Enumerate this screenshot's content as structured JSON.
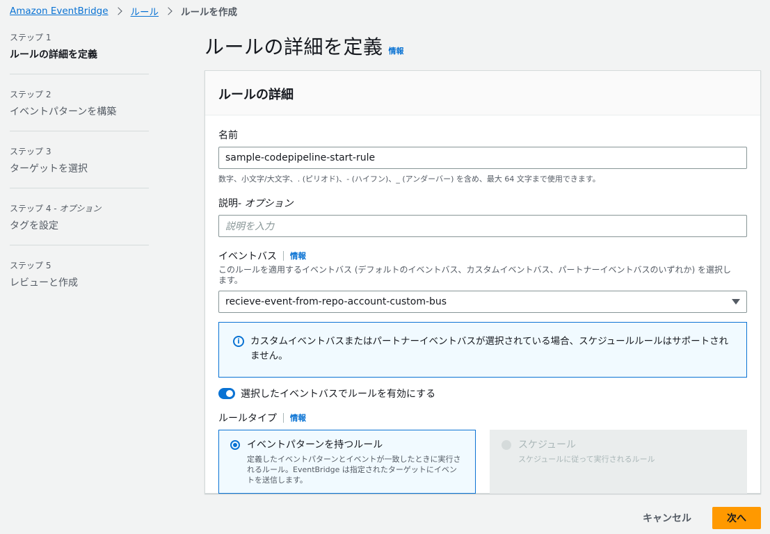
{
  "breadcrumb": {
    "items": [
      "Amazon EventBridge",
      "ルール"
    ],
    "current": "ルールを作成"
  },
  "steps": [
    {
      "num": "ステップ 1",
      "title": "ルールの詳細を定義",
      "active": true
    },
    {
      "num": "ステップ 2",
      "title": "イベントパターンを構築"
    },
    {
      "num": "ステップ 3",
      "title": "ターゲットを選択"
    },
    {
      "num": "ステップ 4",
      "optional": " - オプション",
      "title": "タグを設定"
    },
    {
      "num": "ステップ 5",
      "title": "レビューと作成"
    }
  ],
  "page": {
    "title": "ルールの詳細を定義",
    "info": "情報"
  },
  "panel": {
    "header": "ルールの詳細",
    "name": {
      "label": "名前",
      "value": "sample-codepipeline-start-rule",
      "hint": "数字、小文字/大文字、. (ピリオド)、- (ハイフン)、_ (アンダーバー) を含め、最大 64 文字まで使用できます。"
    },
    "description": {
      "label": "説明",
      "optional": " - オプション",
      "placeholder": "説明を入力"
    },
    "event_bus": {
      "label": "イベントバス",
      "info": "情報",
      "desc": "このルールを適用するイベントバス (デフォルトのイベントバス、カスタムイベントバス、パートナーイベントバスのいずれか) を選択します。",
      "value": "recieve-event-from-repo-account-custom-bus"
    },
    "alert": {
      "icon": "info-icon",
      "text": "カスタムイベントバスまたはパートナーイベントバスが選択されている場合、スケジュールルールはサポートされません。"
    },
    "toggle": {
      "label": "選択したイベントバスでルールを有効にする",
      "on": true
    },
    "rule_type": {
      "label": "ルールタイプ",
      "info": "情報",
      "options": [
        {
          "title": "イベントパターンを持つルール",
          "desc": "定義したイベントパターンとイベントが一致したときに実行されるルール。EventBridge は指定されたターゲットにイベントを送信します。",
          "selected": true
        },
        {
          "title": "スケジュール",
          "desc": "スケジュールに従って実行されるルール",
          "disabled": true
        }
      ]
    }
  },
  "footer": {
    "cancel": "キャンセル",
    "next": "次へ"
  },
  "colors": {
    "accent": "#0972d3",
    "primary_button": "#ff9900",
    "background": "#f2f3f3"
  }
}
